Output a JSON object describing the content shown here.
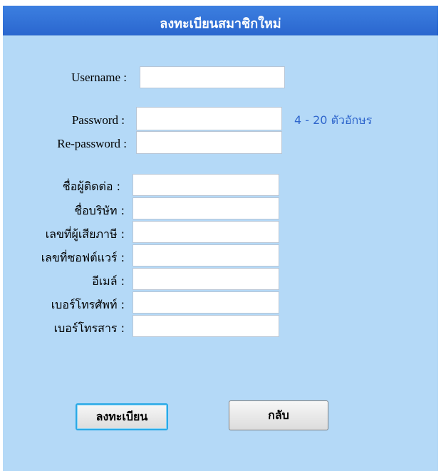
{
  "header": {
    "title": "ลงทะเบียนสมาชิกใหม่"
  },
  "form": {
    "username": {
      "label": "Username :",
      "value": "",
      "placeholder": ""
    },
    "password": {
      "label": "Password :",
      "value": "",
      "placeholder": ""
    },
    "password_hint": "4 - 20 ตัวอักษร",
    "repassword": {
      "label": "Re-password :",
      "value": "",
      "placeholder": ""
    },
    "contact": {
      "label": "ชื่อผู้ติดต่อ :",
      "value": ""
    },
    "company": {
      "label": "ชื่อบริษัท :",
      "value": ""
    },
    "tax_id": {
      "label": "เลขที่ผู้เสียภาษี :",
      "value": ""
    },
    "software_no": {
      "label": "เลขที่ซอฟต์แวร์ :",
      "value": ""
    },
    "email": {
      "label": "อีเมล์ :",
      "value": ""
    },
    "phone": {
      "label": "เบอร์โทรศัพท์ :",
      "value": ""
    },
    "fax": {
      "label": "เบอร์โทรสาร :",
      "value": ""
    }
  },
  "buttons": {
    "register_label": "ลงทะเบียน",
    "back_label": "กลับ"
  }
}
